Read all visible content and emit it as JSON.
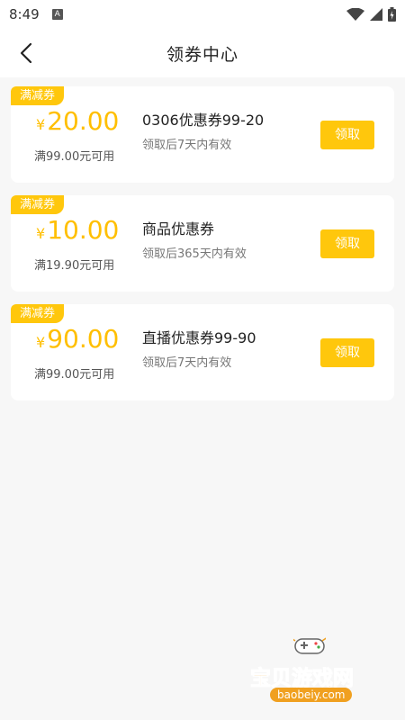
{
  "status": {
    "time": "8:49",
    "notification_icon": "A"
  },
  "nav": {
    "title": "领券中心",
    "back_icon": "chevron-left-icon"
  },
  "colors": {
    "accent": "#ffc70c",
    "amount": "#ffbf00",
    "background": "#f7f7f7"
  },
  "coupons": [
    {
      "tag": "满减券",
      "currency": "¥",
      "amount": "20.00",
      "condition": "满99.00元可用",
      "name": "0306优惠券99-20",
      "validity": "领取后7天内有效",
      "button": "领取"
    },
    {
      "tag": "满减券",
      "currency": "¥",
      "amount": "10.00",
      "condition": "满19.90元可用",
      "name": "商品优惠券",
      "validity": "领取后365天内有效",
      "button": "领取"
    },
    {
      "tag": "满减券",
      "currency": "¥",
      "amount": "90.00",
      "condition": "满99.00元可用",
      "name": "直播优惠券99-90",
      "validity": "领取后7天内有效",
      "button": "领取"
    }
  ],
  "watermark": {
    "text": "宝贝游戏网",
    "url": "baobeiy.com"
  }
}
